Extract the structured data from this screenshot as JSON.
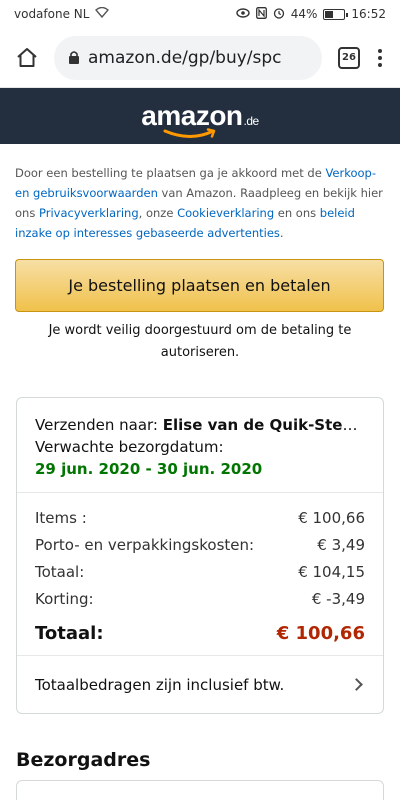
{
  "statusbar": {
    "carrier": "vodafone NL",
    "battery": "44%",
    "battery_level": 0.44,
    "time": "16:52",
    "icons": [
      "wifi-icon",
      "eye-icon",
      "nfc-icon",
      "alarm-icon",
      "battery-icon"
    ]
  },
  "browser": {
    "url": "amazon.de/gp/buy/spc",
    "tab_count": "26"
  },
  "header": {
    "logo_text": "amazon",
    "logo_tld": ".de",
    "bg_color": "#232f3e",
    "smile_color": "#ff9900"
  },
  "legal": {
    "text1": "Door een bestelling te plaatsen ga je akkoord met de ",
    "link1": "Verkoop- en gebruiksvoorwaarden",
    "text2": " van Amazon. Raadpleeg en bekijk hier ons ",
    "link2": "Privacyverklaring",
    "text3": ", onze ",
    "link3": "Cookieverklaring",
    "text4": " en ons ",
    "link4": "beleid inzake op interesses gebaseerde advertenties",
    "text5": "."
  },
  "order": {
    "place_order_label": "Je bestelling plaatsen en betalen",
    "redirect_note": "Je wordt veilig doorgestuurd om de betaling te autoriseren."
  },
  "shipping": {
    "to_label": "Verzenden naar: ",
    "name": "Elise van de Quik-Stee…",
    "expected_label": "Verwachte bezorgdatum:",
    "delivery_date": "29 jun. 2020 - 30 jun. 2020"
  },
  "totals": {
    "rows": [
      {
        "label": "Items :",
        "amount": "€ 100,66"
      },
      {
        "label": "Porto- en verpakkingskosten:",
        "amount": "€ 3,49"
      },
      {
        "label": "Totaal:",
        "amount": "€ 104,15"
      },
      {
        "label": "Korting:",
        "amount": "€ -3,49"
      }
    ],
    "grand_label": "Totaal:",
    "grand_amount": "€ 100,66",
    "vat_note": "Totaalbedragen zijn inclusief btw."
  },
  "address": {
    "section_title": "Bezorgadres"
  }
}
